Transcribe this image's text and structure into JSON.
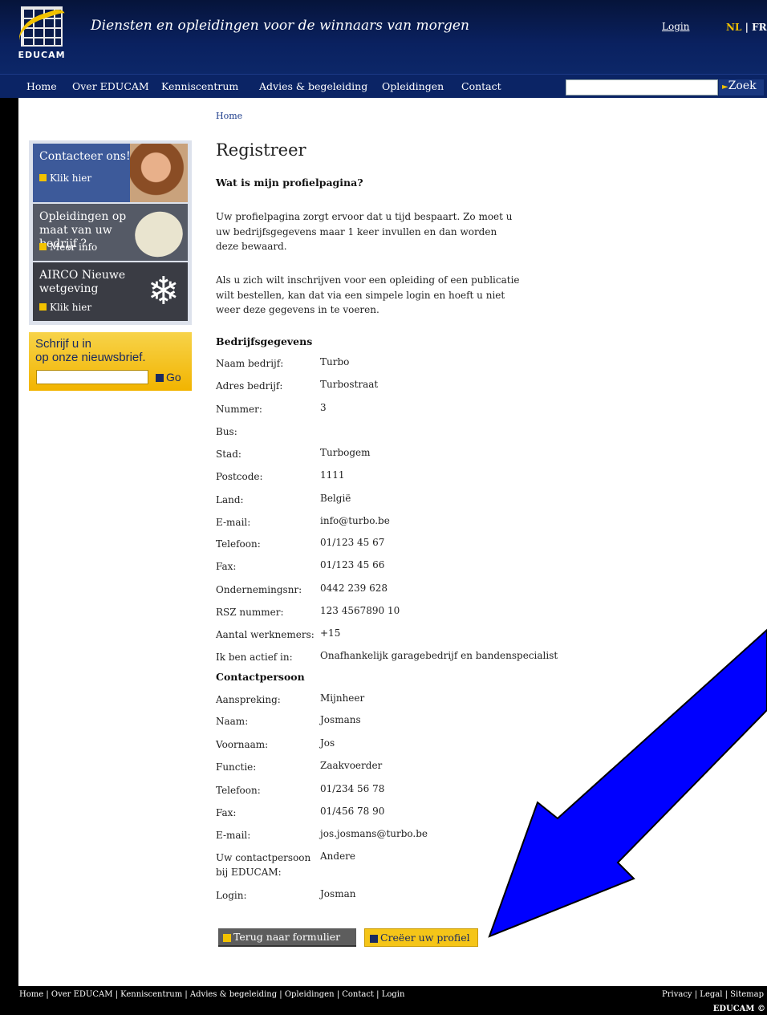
{
  "header": {
    "logo_text": "EDUCAM",
    "tagline": "Diensten en opleidingen voor de winnaars van morgen",
    "login": "Login",
    "lang_nl": "NL",
    "lang_sep": " | ",
    "lang_fr": "FR"
  },
  "nav": {
    "items": [
      "Home",
      "Over EDUCAM",
      "Kenniscentrum",
      "Advies & begeleiding",
      "Opleidingen",
      "Contact"
    ],
    "search_button": "Zoek"
  },
  "breadcrumb": "Home",
  "sidebar": {
    "promos": [
      {
        "title": "Contacteer ons!",
        "cta": "Klik hier"
      },
      {
        "title": "Opleidingen op maat van uw bedrijf ?",
        "cta": "Meer info"
      },
      {
        "title": "AIRCO Nieuwe wetgeving",
        "cta": "Klik hier"
      }
    ],
    "newsletter": {
      "line1": "Schrijf u in",
      "line2": "op onze nieuwsbrief.",
      "button": "Go"
    }
  },
  "main": {
    "title": "Registreer",
    "question": "Wat is mijn profielpagina?",
    "para1": "Uw profielpagina zorgt ervoor dat u tijd bespaart. Zo moet u uw bedrijfsgegevens maar 1 keer invullen en dan worden deze bewaard.",
    "para2": "Als u zich wilt inschrijven voor een opleiding of een publicatie wilt bestellen, kan dat via een simpele login en hoeft u niet weer deze gegevens in te voeren.",
    "company_heading": "Bedrijfsgegevens",
    "company_fields": [
      {
        "label": "Naam bedrijf:",
        "value": "Turbo"
      },
      {
        "label": "Adres bedrijf:",
        "value": "Turbostraat"
      },
      {
        "label": "Nummer:",
        "value": "3"
      },
      {
        "label": "Bus:",
        "value": ""
      },
      {
        "label": "Stad:",
        "value": "Turbogem"
      },
      {
        "label": "Postcode:",
        "value": "1111"
      },
      {
        "label": "Land:",
        "value": "België"
      },
      {
        "label": "E-mail:",
        "value": "info@turbo.be"
      },
      {
        "label": "Telefoon:",
        "value": "01/123 45 67"
      },
      {
        "label": "Fax:",
        "value": "01/123 45 66"
      },
      {
        "label": "Ondernemingsnr:",
        "value": "0442 239 628"
      },
      {
        "label": "RSZ nummer:",
        "value": "123 4567890 10"
      },
      {
        "label": "Aantal werknemers:",
        "value": "+15"
      },
      {
        "label": "Ik ben actief in:",
        "value": "Onafhankelijk garagebedrijf en bandenspecialist"
      }
    ],
    "contact_heading": "Contactpersoon",
    "contact_fields": [
      {
        "label": "Aanspreking:",
        "value": "Mijnheer"
      },
      {
        "label": "Naam:",
        "value": "Josmans"
      },
      {
        "label": "Voornaam:",
        "value": "Jos"
      },
      {
        "label": "Functie:",
        "value": "Zaakvoerder"
      },
      {
        "label": "Telefoon:",
        "value": "01/234 56 78"
      },
      {
        "label": "Fax:",
        "value": "01/456 78 90"
      },
      {
        "label": "E-mail:",
        "value": "jos.josmans@turbo.be"
      },
      {
        "label": "Uw contactpersoon bij EDUCAM:",
        "value": "Andere"
      },
      {
        "label": "Login:",
        "value": "Josman"
      }
    ],
    "back_button": "Terug naar formulier",
    "create_button": "Creëer uw profiel"
  },
  "footer": {
    "links": "Home | Over EDUCAM | Kenniscentrum | Advies & begeleiding | Opleidingen | Contact | Login",
    "right_links": "Privacy | Legal | Sitemap",
    "copyright": "EDUCAM ©"
  },
  "colors": {
    "accent": "#f2c200",
    "nav": "#0b2465",
    "arrow": "#0000ff"
  }
}
